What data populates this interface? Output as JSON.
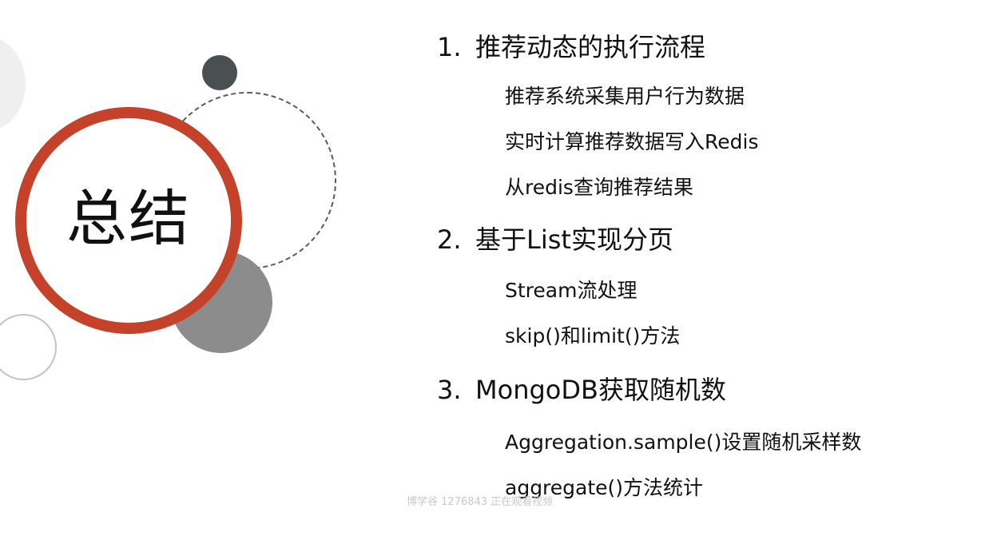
{
  "title": "总结",
  "sections": [
    {
      "num": "1.",
      "heading": "推荐动态的执行流程",
      "items": [
        "推荐系统采集用户行为数据",
        "实时计算推荐数据写入Redis",
        "从redis查询推荐结果"
      ]
    },
    {
      "num": "2.",
      "heading": "基于List实现分页",
      "items": [
        "Stream流处理",
        "skip()和limit()方法"
      ]
    },
    {
      "num": "3.",
      "heading": "MongoDB获取随机数",
      "items": [
        "Aggregation.sample()设置随机采样数",
        "aggregate()方法统计"
      ]
    }
  ],
  "watermark": "博学谷 1276843 正在观看视频",
  "colors": {
    "accent": "#c5422a",
    "dark_dot": "#4a4f51",
    "gray_fill": "#8c8c8c"
  }
}
